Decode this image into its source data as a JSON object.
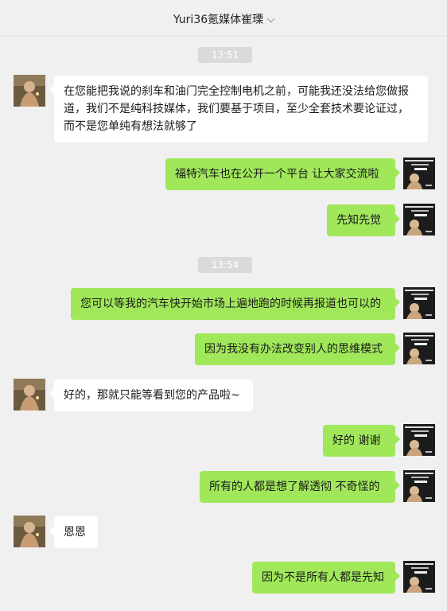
{
  "header": {
    "title": "Yuri36氪媒体崔瑮"
  },
  "colors": {
    "outgoing_bubble": "#a0e75a",
    "incoming_bubble": "#ffffff",
    "background": "#f0f0f0"
  },
  "timestamps": [
    "13:51",
    "13:54"
  ],
  "messages": [
    {
      "side": "in",
      "text": "在您能把我说的刹车和油门完全控制电机之前，可能我还没法给您做报道，我们不是纯科技媒体，我们要基于项目，至少全套技术要论证过，而不是您单纯有想法就够了"
    },
    {
      "side": "out",
      "text": "福特汽车也在公开一个平台  让大家交流啦"
    },
    {
      "side": "out",
      "text": "先知先觉"
    },
    {
      "side": "out",
      "text": "您可以等我的汽车快开始市场上遍地跑的时候再报道也可以的"
    },
    {
      "side": "out",
      "text": "因为我没有办法改变别人的思维模式"
    },
    {
      "side": "in",
      "text": "好的，那就只能等看到您的产品啦~"
    },
    {
      "side": "out",
      "text": "好的  谢谢"
    },
    {
      "side": "out",
      "text": "所有的人都是想了解透彻  不奇怪的"
    },
    {
      "side": "in",
      "text": "恩恩"
    },
    {
      "side": "out",
      "text": "因为不是所有人都是先知"
    }
  ],
  "avatars": {
    "other": "contact-avatar",
    "self": "own-avatar"
  }
}
